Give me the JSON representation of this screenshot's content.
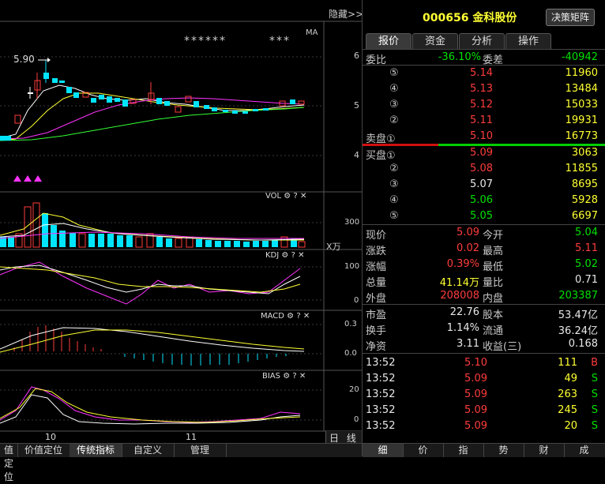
{
  "chart_panel": {
    "hide_label": "隐藏",
    "ma_label": "MA",
    "stars_a": "******",
    "stars_b": "***",
    "high_marker": "5.90",
    "price_axis": [
      "6",
      "5",
      "4"
    ],
    "vol": {
      "label": "VOL",
      "axis": [
        "300"
      ],
      "unit": "X万"
    },
    "kdj": {
      "label": "KDJ",
      "axis": [
        "100",
        "0"
      ]
    },
    "macd": {
      "label": "MACD",
      "axis": [
        "0.3",
        "0.0"
      ]
    },
    "bias": {
      "label": "BIAS",
      "axis": [
        "20",
        "0"
      ]
    },
    "date_labels": [
      "10",
      "11"
    ],
    "period_tabs": [
      "日",
      "线"
    ],
    "icons": {
      "gear": "⚙",
      "help": "?",
      "close": "✕"
    }
  },
  "bottom_tabs": [
    "值定位",
    "价值定位",
    "传统指标",
    "自定义",
    "管理"
  ],
  "bottom_tabs_active": 2,
  "stock": {
    "code": "000656",
    "name": "金科股份",
    "decision_button": "决策矩阵"
  },
  "tabs": [
    "报价",
    "资金",
    "分析",
    "操作"
  ],
  "order_book": {
    "weibi_label": "委比",
    "weibi_value": "-36.10%",
    "weicha_label": "委差",
    "weicha_value": "-40942",
    "sell": [
      {
        "label": "⑤",
        "price": "5.14",
        "vol": "11960"
      },
      {
        "label": "④",
        "price": "5.13",
        "vol": "13484"
      },
      {
        "label": "③",
        "price": "5.12",
        "vol": "15033"
      },
      {
        "label": "②",
        "price": "5.11",
        "vol": "19931"
      },
      {
        "label": "卖盘①",
        "price": "5.10",
        "vol": "16773"
      }
    ],
    "buy": [
      {
        "label": "买盘①",
        "price": "5.09",
        "vol": "3063"
      },
      {
        "label": "②",
        "price": "5.08",
        "vol": "11855"
      },
      {
        "label": "③",
        "price": "5.07",
        "vol": "8695"
      },
      {
        "label": "④",
        "price": "5.06",
        "vol": "5928"
      },
      {
        "label": "⑤",
        "price": "5.05",
        "vol": "6697"
      }
    ]
  },
  "quote": [
    {
      "l1": "现价",
      "v1": "5.09",
      "l2": "今开",
      "v2": "5.04"
    },
    {
      "l1": "涨跌",
      "v1": "0.02",
      "l2": "最高",
      "v2": "5.11"
    },
    {
      "l1": "涨幅",
      "v1": "0.39%",
      "l2": "最低",
      "v2": "5.02"
    },
    {
      "l1": "总量",
      "v1": "41.14万",
      "l2": "量比",
      "v2": "0.71"
    },
    {
      "l1": "外盘",
      "v1": "208008",
      "l2": "内盘",
      "v2": "203387"
    },
    {
      "l1": "市盈",
      "v1": "22.76",
      "l2": "股本",
      "v2": "53.47亿"
    },
    {
      "l1": "换手",
      "v1": "1.14%",
      "l2": "流通",
      "v2": "36.24亿"
    },
    {
      "l1": "净资",
      "v1": "3.11",
      "l2": "收益(三)",
      "v2": "0.168"
    }
  ],
  "ticks": [
    {
      "time": "13:52",
      "price": "5.10",
      "vol": "111",
      "side": "B"
    },
    {
      "time": "13:52",
      "price": "5.09",
      "vol": "49",
      "side": "S"
    },
    {
      "time": "13:52",
      "price": "5.09",
      "vol": "263",
      "side": "S"
    },
    {
      "time": "13:52",
      "price": "5.09",
      "vol": "245",
      "side": "S"
    },
    {
      "time": "13:52",
      "price": "5.09",
      "vol": "20",
      "side": "S"
    }
  ],
  "right_bottom_tabs": [
    "细",
    "价",
    "指",
    "势",
    "财",
    "成"
  ],
  "colors": {
    "up": "#ff3c3c",
    "down": "#00e000",
    "bear_candle": "#00e5ff",
    "ma5": "#ffffff",
    "ma10": "#ffff33",
    "ma20": "#ff33ff",
    "ma60": "#33ff33"
  }
}
